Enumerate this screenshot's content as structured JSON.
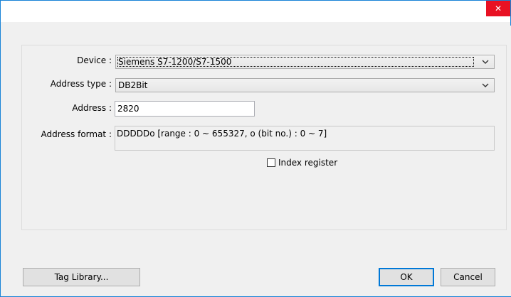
{
  "window": {
    "close_symbol": "✕"
  },
  "form": {
    "device_label": "Device :",
    "device_value": "Siemens S7-1200/S7-1500",
    "address_type_label": "Address type :",
    "address_type_value": "DB2Bit",
    "address_label": "Address :",
    "address_value": "2820",
    "format_label": "Address format :",
    "format_value": "DDDDDo [range : 0 ~ 655327, o (bit no.) : 0 ~ 7]",
    "index_register_label": "Index register",
    "index_register_checked": false
  },
  "buttons": {
    "tag_library": "Tag Library...",
    "ok": "OK",
    "cancel": "Cancel"
  },
  "icons": {
    "close": "close-icon",
    "dropdown": "chevron-down-icon"
  },
  "colors": {
    "close_bg": "#e81123",
    "window_border": "#1883d7",
    "dialog_bg": "#f0f0f0"
  }
}
